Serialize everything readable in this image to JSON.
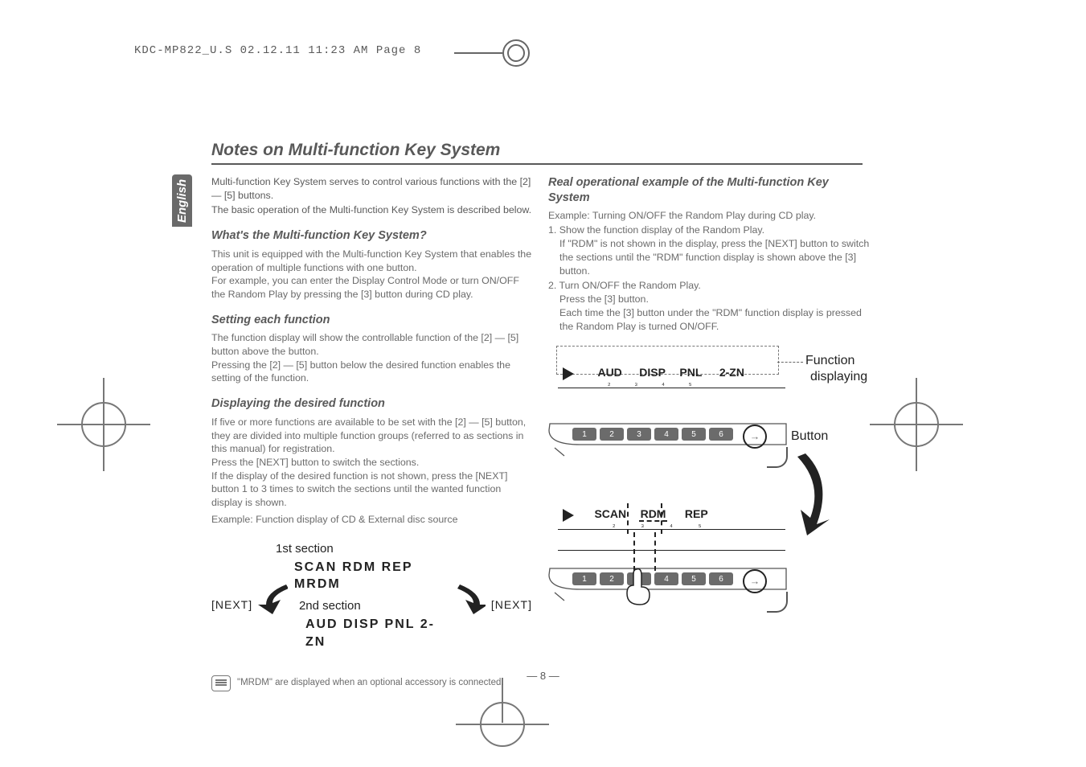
{
  "file_header": "KDC-MP822_U.S  02.12.11  11:23 AM  Page 8",
  "lang_tab": "English",
  "title": "Notes on Multi-function Key System",
  "intro_l1": "Multi-function Key System serves to control various functions with the [2] — [5] buttons.",
  "intro_l2": "The basic operation of the Multi-function Key System is described below.",
  "s1_h": "What's the Multi-function Key System?",
  "s1_p1": "This unit is equipped with the Multi-function Key System that enables the operation of multiple functions with one button.",
  "s1_p2": "For example, you can enter the Display Control Mode or turn ON/OFF the Random Play by pressing the [3] button during CD play.",
  "s2_h": "Setting each function",
  "s2_p1": "The function display will show the controllable function of the [2] — [5] button above the button.",
  "s2_p2": "Pressing the [2] — [5] button below the desired function enables the setting of the function.",
  "s3_h": "Displaying the desired function",
  "s3_p1": "If five or more functions are available to be set with the [2] — [5] button, they are divided into multiple function groups (referred to as sections in this manual) for registration.",
  "s3_p2": "Press the [NEXT] button to switch the sections.",
  "s3_p3": "If the display of the desired function is not shown, press the [NEXT] button 1 to 3 times to switch the sections until the wanted function display is shown.",
  "s3_ex": "Example: Function display of CD & External disc source",
  "sec1_lbl": "1st section",
  "sec1_words": "SCAN  RDM   REP  MRDM",
  "sec2_lbl": "2nd section",
  "sec2_words": "AUD  DISP  PNL  2-ZN",
  "next_l": "[NEXT]",
  "next_r": "[NEXT]",
  "note_mrdm": "\"MRDM\" are displayed when an optional accessory is connected.",
  "r_h": "Real operational example of the Multi-function Key System",
  "r_ex": "Example: Turning ON/OFF the Random Play during CD play.",
  "r_s1": "1. Show the function display of the Random Play.",
  "r_s1b": "If \"RDM\" is not shown in the display, press the [NEXT] button to switch the sections until the \"RDM\" function display is shown above the [3] button.",
  "r_s2": "2. Turn ON/OFF the Random Play.",
  "r_s2a": "Press the [3] button.",
  "r_s2b": "Each time the [3] button under the \"RDM\" function display is pressed the Random Play is turned ON/OFF.",
  "side_fn1": "Function",
  "side_fn2": "displaying",
  "side_btn": "Button",
  "disp_aud": "AUD",
  "disp_disp": "DISP",
  "disp_pnl": "PNL",
  "disp_2zn": "2-ZN",
  "disp_scan": "SCAN",
  "disp_rdm": "RDM",
  "disp_rep": "REP",
  "pgno": "— 8 —"
}
